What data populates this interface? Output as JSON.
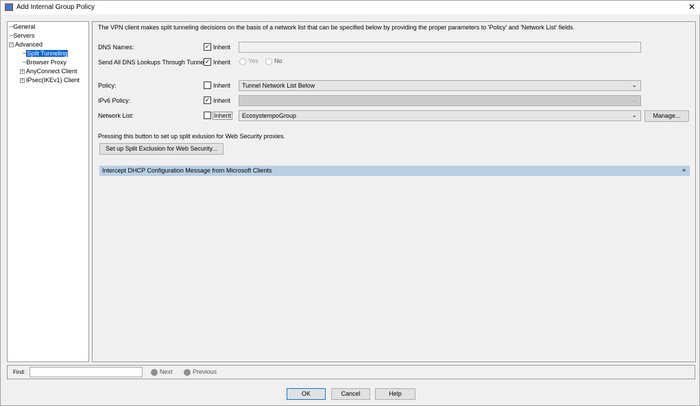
{
  "window": {
    "title": "Add Internal Group Policy",
    "close": "✕"
  },
  "tree": {
    "items": [
      {
        "label": "General"
      },
      {
        "label": "Servers"
      },
      {
        "label": "Advanced"
      },
      {
        "label": "Split Tunneling"
      },
      {
        "label": "Browser Proxy"
      },
      {
        "label": "AnyConnect Client"
      },
      {
        "label": "IPsec(IKEv1) Client"
      }
    ]
  },
  "main": {
    "intro": "The VPN client makes split tunneling decisions on the basis of a network list that can be specified below by providing the proper parameters to 'Policy' and 'Network List' fields.",
    "inherit": "Inherit",
    "dns_names": {
      "label": "DNS Names:",
      "inherit": true,
      "value": ""
    },
    "send_all": {
      "label": "Send All DNS Lookups Through Tunnel:",
      "inherit": true,
      "yes": "Yes",
      "no": "No"
    },
    "policy": {
      "label": "Policy:",
      "inherit": false,
      "value": "Tunnel Network List Below"
    },
    "ipv6": {
      "label": "IPv6 Policy:",
      "inherit": true,
      "value": ""
    },
    "network_list": {
      "label": "Network List:",
      "inherit": false,
      "value": "EcosystempoGroup",
      "manage": "Manage..."
    },
    "exclusion_text": "Pressing this button to set up split exlusion for Web Security proxies.",
    "exclusion_button": "Set up Split Exclusion for Web Security...",
    "intercept": "Intercept DHCP Configuration Message from Microsoft Clients",
    "intercept_icon": "»"
  },
  "find": {
    "label": "Find:",
    "value": "",
    "next": "Next",
    "previous": "Previous"
  },
  "buttons": {
    "ok": "OK",
    "cancel": "Cancel",
    "help": "Help"
  },
  "check": "✓"
}
